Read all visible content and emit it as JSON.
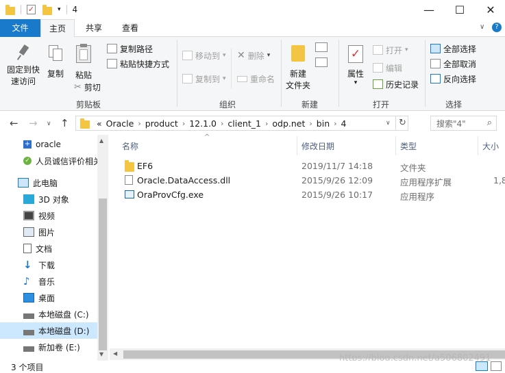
{
  "window": {
    "title": "4",
    "minimize": "—",
    "maximize": "☐",
    "close": "✕"
  },
  "tabs": [
    {
      "label": "文件"
    },
    {
      "label": "主页"
    },
    {
      "label": "共享"
    },
    {
      "label": "查看"
    }
  ],
  "ribbon": {
    "clipboard": {
      "pin_label": "固定到快",
      "pin_label2": "速访问",
      "copy": "复制",
      "paste": "粘贴",
      "copy_path": "复制路径",
      "paste_shortcut": "粘贴快捷方式",
      "cut": "剪切",
      "group": "剪贴板"
    },
    "organize": {
      "move_to": "移动到",
      "copy_to": "复制到",
      "delete": "删除",
      "rename": "重命名",
      "group": "组织"
    },
    "new": {
      "new_folder": "新建",
      "new_folder2": "文件夹",
      "group": "新建"
    },
    "open": {
      "properties": "属性",
      "open": "打开",
      "edit": "编辑",
      "history": "历史记录",
      "group": "打开"
    },
    "select": {
      "select_all": "全部选择",
      "select_none": "全部取消",
      "invert": "反向选择",
      "group": "选择"
    }
  },
  "address": {
    "prefix": "«",
    "crumbs": [
      "Oracle",
      "product",
      "12.1.0",
      "client_1",
      "odp.net",
      "bin",
      "4"
    ],
    "search_placeholder": "搜索\"4\""
  },
  "nav": {
    "items": [
      {
        "label": "oracle"
      },
      {
        "label": "人员诚信评价相关"
      },
      {
        "label": "此电脑"
      },
      {
        "label": "3D 对象"
      },
      {
        "label": "视频"
      },
      {
        "label": "图片"
      },
      {
        "label": "文档"
      },
      {
        "label": "下载"
      },
      {
        "label": "音乐"
      },
      {
        "label": "桌面"
      },
      {
        "label": "本地磁盘 (C:)"
      },
      {
        "label": "本地磁盘 (D:)"
      },
      {
        "label": "新加卷 (E:)"
      }
    ]
  },
  "columns": {
    "name": "名称",
    "modified": "修改日期",
    "type": "类型",
    "size": "大小"
  },
  "files": [
    {
      "name": "EF6",
      "modified": "2019/11/7 14:18",
      "type": "文件夹",
      "size": ""
    },
    {
      "name": "Oracle.DataAccess.dll",
      "modified": "2015/9/26 12:09",
      "type": "应用程序扩展",
      "size": "1,8"
    },
    {
      "name": "OraProvCfg.exe",
      "modified": "2015/9/26 10:17",
      "type": "应用程序",
      "size": ""
    }
  ],
  "status": {
    "count": "3 个项目"
  },
  "watermark": "https://blog.csdn.net/a506802491"
}
